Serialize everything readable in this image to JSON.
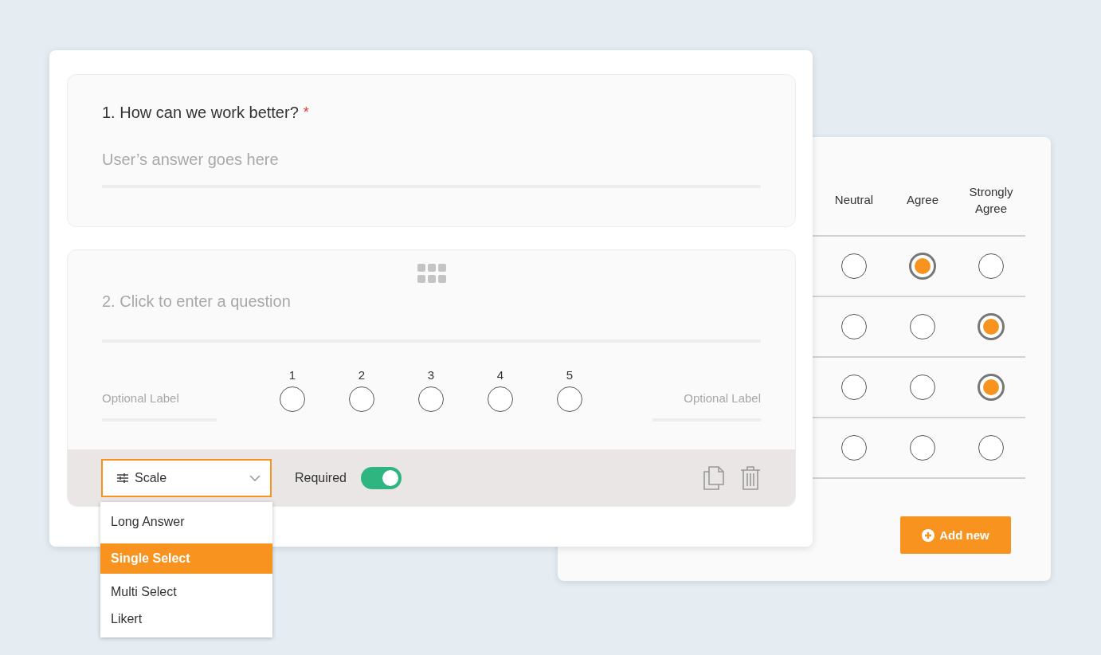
{
  "likert": {
    "columns": [
      "Neutral",
      "Agree",
      "Strongly Agree"
    ],
    "rows": [
      {
        "options": [
          {
            "selected": false
          },
          {
            "selected": true
          },
          {
            "selected": false
          }
        ]
      },
      {
        "options": [
          {
            "selected": false
          },
          {
            "selected": false
          },
          {
            "selected": true
          }
        ]
      },
      {
        "options": [
          {
            "selected": false
          },
          {
            "selected": false
          },
          {
            "selected": true
          }
        ]
      },
      {
        "options": [
          {
            "selected": false
          },
          {
            "selected": false
          },
          {
            "selected": false
          }
        ]
      }
    ],
    "add_button": "Add new"
  },
  "questions": [
    {
      "kind": "text",
      "title": "1. How can we work better?",
      "required_mark": "*",
      "answer": {
        "placeholder": "User’s answer goes here"
      }
    },
    {
      "kind": "scale",
      "question": {
        "placeholder": "2. Click to enter a question"
      },
      "low_label": {
        "placeholder": "Optional Label"
      },
      "high_label": {
        "placeholder": "Optional Label"
      },
      "points": [
        {
          "label": "1",
          "selected": false
        },
        {
          "label": "2",
          "selected": false
        },
        {
          "label": "3",
          "selected": false
        },
        {
          "label": "4",
          "selected": false
        },
        {
          "label": "5",
          "selected": false
        }
      ],
      "type_select": {
        "value": "Scale"
      },
      "required_toggle": {
        "label": "Required",
        "on": true
      }
    }
  ],
  "type_menu": [
    {
      "label": "Long Answer",
      "selected": false
    },
    {
      "label": "Single Select",
      "selected": true
    },
    {
      "label": "Multi Select",
      "selected": false
    },
    {
      "label": "Likert",
      "selected": false
    }
  ]
}
